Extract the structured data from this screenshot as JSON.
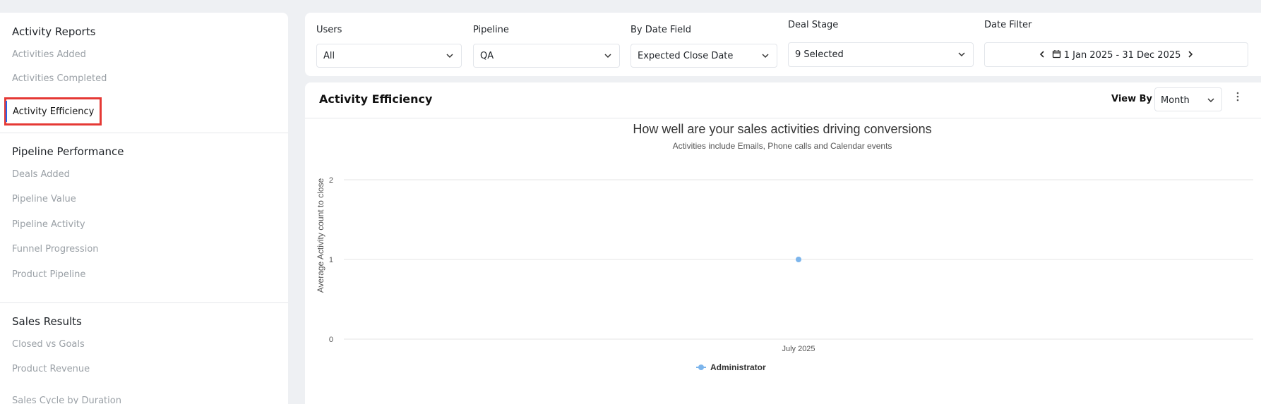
{
  "sidebar": {
    "sections": [
      {
        "title": "Activity Reports",
        "items": [
          "Activities Added",
          "Activities Completed",
          "Activity Efficiency"
        ]
      },
      {
        "title": "Pipeline Performance",
        "items": [
          "Deals Added",
          "Pipeline Value",
          "Pipeline Activity",
          "Funnel Progression",
          "Product Pipeline"
        ]
      },
      {
        "title": "Sales Results",
        "items": [
          "Closed vs Goals",
          "Product Revenue",
          "Sales Cycle by Duration"
        ]
      }
    ],
    "active_item": "Activity Efficiency"
  },
  "filters": {
    "users": {
      "label": "Users",
      "value": "All"
    },
    "pipeline": {
      "label": "Pipeline",
      "value": "QA"
    },
    "date_field": {
      "label": "By Date Field",
      "value": "Expected Close Date"
    },
    "deal_stage": {
      "label": "Deal Stage",
      "value": "9 Selected"
    },
    "date_filter": {
      "label": "Date Filter",
      "value": "1 Jan 2025 - 31 Dec 2025"
    }
  },
  "panel": {
    "title": "Activity Efficiency",
    "view_by_label": "View By",
    "view_by_value": "Month"
  },
  "colors": {
    "accent": "#2563eb",
    "highlight_border": "#e53935",
    "series": "#7cb5ec",
    "gridline": "#e6e6e6"
  },
  "chart_data": {
    "type": "line",
    "title": "How well are your sales activities driving conversions",
    "subtitle": "Activities include Emails, Phone calls and Calendar events",
    "ylabel": "Average Activity count to close",
    "xlabel": "",
    "categories": [
      "July 2025"
    ],
    "series": [
      {
        "name": "Administrator",
        "values": [
          1
        ],
        "color": "#7cb5ec"
      }
    ],
    "ylim": [
      0,
      2
    ],
    "yticks": [
      0,
      1,
      2
    ],
    "grid": true,
    "legend": "bottom-center"
  }
}
